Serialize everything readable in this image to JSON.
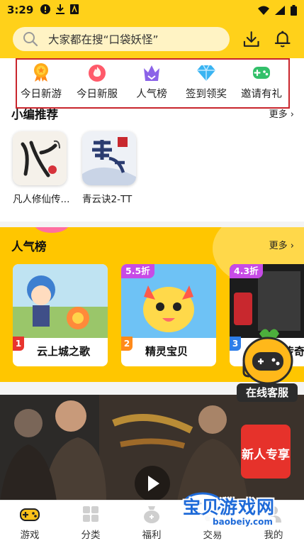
{
  "status_bar": {
    "time": "3:29"
  },
  "search": {
    "placeholder": "大家都在搜“口袋妖怪”"
  },
  "quick_nav": [
    {
      "label": "今日新游",
      "icon": "medal-icon",
      "color": "#ffaa1a"
    },
    {
      "label": "今日新服",
      "icon": "flame-icon",
      "color": "#ff5a5a"
    },
    {
      "label": "人气榜",
      "icon": "crown-icon",
      "color": "#8b63e8"
    },
    {
      "label": "签到领奖",
      "icon": "diamond-icon",
      "color": "#3ab4f2"
    },
    {
      "label": "邀请有礼",
      "icon": "gamepad-icon",
      "color": "#33c06a"
    }
  ],
  "editor_picks": {
    "title": "小编推荐",
    "more": "更多",
    "games": [
      {
        "name": "凡人修仙传..."
      },
      {
        "name": "青云诀2-TT"
      }
    ]
  },
  "popular": {
    "title": "人气榜",
    "more": "更多",
    "games": [
      {
        "rank": "1",
        "name": "云上城之歌",
        "rank_color": "#e8342e"
      },
      {
        "rank": "2",
        "name": "精灵宝贝",
        "rank_color": "#ff8a1a",
        "badge": "5.5折"
      },
      {
        "rank": "3",
        "name": "传奇",
        "rank_color": "#2d7ee8",
        "badge": "4.3折"
      }
    ]
  },
  "mascot": {
    "label": "在线客服"
  },
  "banner": {
    "badge": "新人专享"
  },
  "watermark": {
    "text": "宝贝游戏网",
    "url": "baobeiy.com"
  },
  "bottom_nav": [
    {
      "label": "游戏",
      "icon": "gamepad-icon"
    },
    {
      "label": "分类",
      "icon": "grid-icon"
    },
    {
      "label": "福利",
      "icon": "gift-bag-icon"
    },
    {
      "label": "交易",
      "icon": "trade-icon"
    },
    {
      "label": "我的",
      "icon": "user-icon"
    }
  ]
}
